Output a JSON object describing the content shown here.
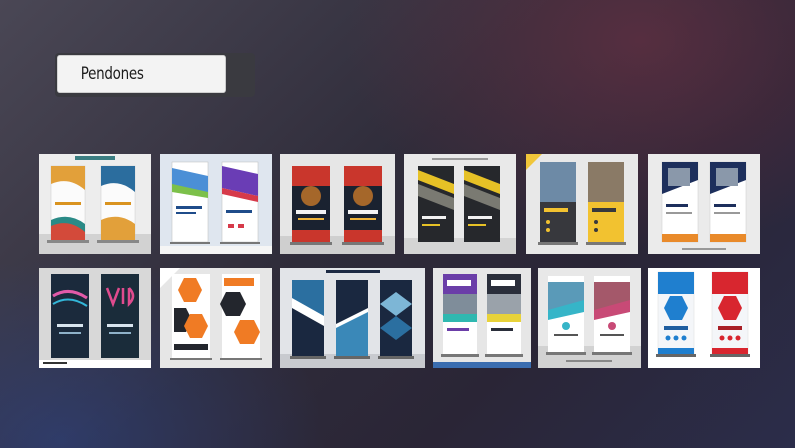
{
  "page": {
    "title": "Pendones"
  },
  "gallery": {
    "items": [
      {
        "name": "abstract-roll-up-banner-thumb"
      },
      {
        "name": "roll-up-template-thumb"
      },
      {
        "name": "restaurant-roll-up-thumb"
      },
      {
        "name": "dark-yellow-roll-up-thumb"
      },
      {
        "name": "tools-repair-roll-up-thumb"
      },
      {
        "name": "blue-orange-business-roll-up-thumb"
      },
      {
        "name": "summer-party-vip-roll-up-thumb"
      },
      {
        "name": "orange-hexagon-roll-up-thumb"
      },
      {
        "name": "blue-geometric-roll-up-thumb"
      },
      {
        "name": "banner-purple-roll-up-thumb"
      },
      {
        "name": "city-photo-roll-up-thumb"
      },
      {
        "name": "hexagon-roll-up-thumb"
      }
    ]
  }
}
